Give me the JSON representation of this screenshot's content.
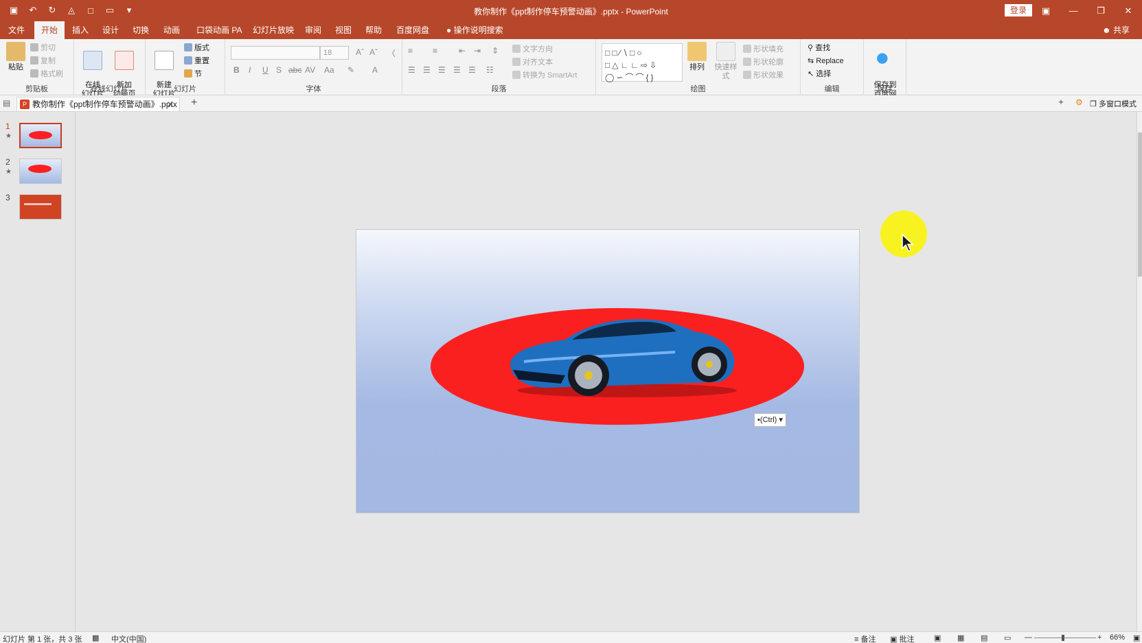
{
  "window": {
    "title": "教你制作《ppt制作停车预警动画》.pptx  -  PowerPoint",
    "login_label": "登录",
    "share_label": "共享",
    "controls": [
      "restore-ribbon",
      "minimize",
      "restore",
      "close"
    ]
  },
  "tabs": [
    {
      "label": "文件",
      "active": false
    },
    {
      "label": "开始",
      "active": true
    },
    {
      "label": "插入",
      "active": false
    },
    {
      "label": "设计",
      "active": false
    },
    {
      "label": "切换",
      "active": false
    },
    {
      "label": "动画",
      "active": false
    },
    {
      "label": "口袋动画 PA",
      "active": false
    },
    {
      "label": "幻灯片放映",
      "active": false
    },
    {
      "label": "审阅",
      "active": false
    },
    {
      "label": "视图",
      "active": false
    },
    {
      "label": "帮助",
      "active": false
    },
    {
      "label": "百度网盘",
      "active": false
    },
    {
      "label": "操作说明搜索",
      "active": false
    }
  ],
  "ribbon": {
    "clipboard": {
      "label": "剪贴板",
      "paste": "粘贴",
      "cut": "剪切",
      "copy": "复制",
      "format_painter": "格式刷"
    },
    "online_slides": {
      "label": "在线幻灯片",
      "online": "在线\n幻灯片",
      "new_anim": "新加\n动画页"
    },
    "slides": {
      "label": "幻灯片",
      "new_slide": "新建\n幻灯片",
      "layout": "版式",
      "reset": "重置",
      "section": "节"
    },
    "font": {
      "label": "字体",
      "font_name": "",
      "font_size": "18"
    },
    "paragraph": {
      "label": "段落",
      "text_direction": "文字方向",
      "align_text": "对齐文本",
      "smartart": "转换为 SmartArt"
    },
    "drawing": {
      "label": "绘图",
      "arrange": "排列",
      "quick_styles": "快速样式",
      "shape_fill": "形状填充",
      "shape_outline": "形状轮廓",
      "shape_effects": "形状效果"
    },
    "editing": {
      "label": "编辑",
      "find": "查找",
      "replace": "Replace",
      "select": "选择"
    },
    "save": {
      "label": "保存",
      "save_baidu": "保存到\n百度网盘"
    }
  },
  "doc_tab": {
    "name": "教你制作《ppt制作停车预警动画》.pptx",
    "multi_window": "多窗口模式"
  },
  "thumbnails": [
    {
      "num": "1",
      "star": "★"
    },
    {
      "num": "2",
      "star": "★"
    },
    {
      "num": "3",
      "star": ""
    }
  ],
  "paste_options": {
    "label": "(Ctrl)"
  },
  "status": {
    "slide_info": "幻灯片 第 1 张，共 3 张",
    "language": "中文(中国)",
    "notes": "备注",
    "comments": "批注",
    "zoom": "66%"
  },
  "colors": {
    "accent": "#b7472a",
    "ellipse": "#fb2020",
    "car": "#1f6fc0",
    "highlight": "#f8f320"
  }
}
